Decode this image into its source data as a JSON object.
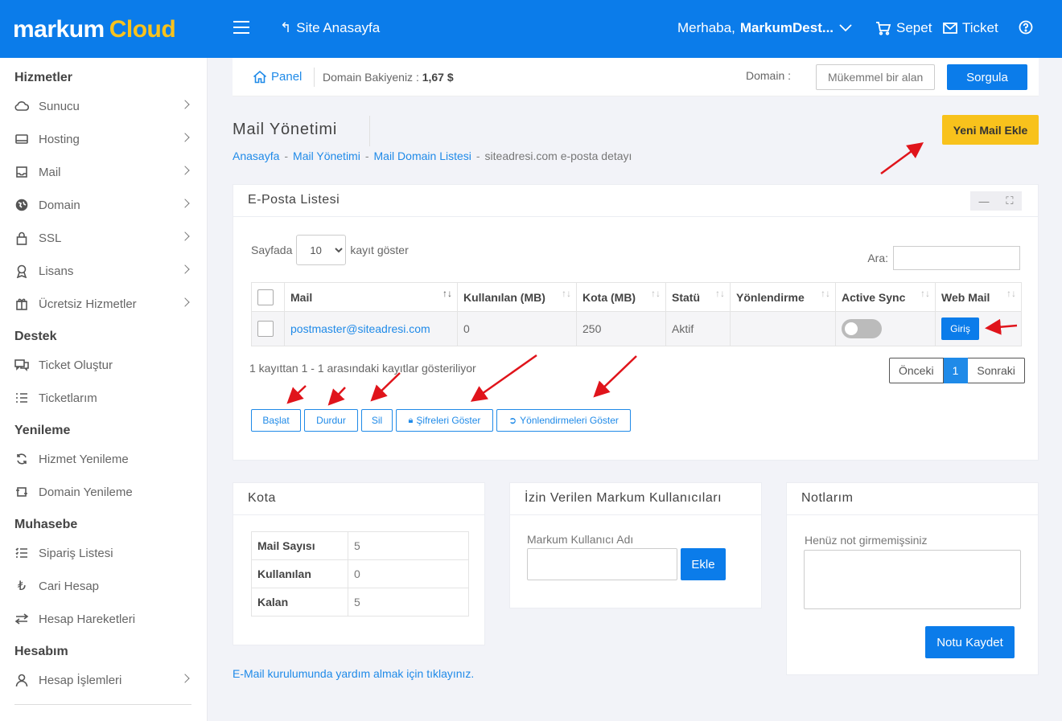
{
  "header": {
    "logo_main": "markum",
    "logo_accent": "Cloud",
    "site_home": "Site Anasayfa",
    "greeting": "Merhaba,",
    "username": "MarkumDest...",
    "cart": "Sepet",
    "ticket": "Ticket"
  },
  "sidebar": {
    "sections": [
      {
        "title": "Hizmetler",
        "items": [
          {
            "label": "Sunucu",
            "icon": "cloud-icon",
            "chevron": true
          },
          {
            "label": "Hosting",
            "icon": "server-icon",
            "chevron": true
          },
          {
            "label": "Mail",
            "icon": "inbox-icon",
            "chevron": true
          },
          {
            "label": "Domain",
            "icon": "globe-icon",
            "chevron": true
          },
          {
            "label": "SSL",
            "icon": "lock-icon",
            "chevron": true
          },
          {
            "label": "Lisans",
            "icon": "award-icon",
            "chevron": true
          },
          {
            "label": "Ücretsiz Hizmetler",
            "icon": "gift-icon",
            "chevron": true
          }
        ]
      },
      {
        "title": "Destek",
        "items": [
          {
            "label": "Ticket Oluştur",
            "icon": "chat-icon",
            "chevron": false
          },
          {
            "label": "Ticketlarım",
            "icon": "list-icon",
            "chevron": false
          }
        ]
      },
      {
        "title": "Yenileme",
        "items": [
          {
            "label": "Hizmet Yenileme",
            "icon": "refresh-icon",
            "chevron": false
          },
          {
            "label": "Domain Yenileme",
            "icon": "renew-icon",
            "chevron": false
          }
        ]
      },
      {
        "title": "Muhasebe",
        "items": [
          {
            "label": "Sipariş Listesi",
            "icon": "checklist-icon",
            "chevron": false
          },
          {
            "label": "Cari Hesap",
            "icon": "lira-icon",
            "chevron": false
          },
          {
            "label": "Hesap Hareketleri",
            "icon": "transfer-icon",
            "chevron": false
          }
        ]
      },
      {
        "title": "Hesabım",
        "items": [
          {
            "label": "Hesap İşlemleri",
            "icon": "user-icon",
            "chevron": true
          }
        ]
      }
    ]
  },
  "panelbar": {
    "panel": "Panel",
    "balance_label": "Domain Bakiyeniz :",
    "balance_value": "1,67 $",
    "domain_label": "Domain :",
    "domain_placeholder": "Mükemmel bir alan",
    "search_button": "Sorgula"
  },
  "page": {
    "title": "Mail Yönetimi",
    "breadcrumb": [
      "Anasayfa",
      "Mail Yönetimi",
      "Mail Domain Listesi",
      "siteadresi.com e-posta detayı"
    ],
    "new_mail_button": "Yeni Mail Ekle"
  },
  "email_list": {
    "title": "E-Posta Listesi",
    "length_prefix": "Sayfada",
    "length_value": "10",
    "length_suffix": "kayıt göster",
    "search_label": "Ara:",
    "columns": [
      "Mail",
      "Kullanılan (MB)",
      "Kota (MB)",
      "Statü",
      "Yönlendirme",
      "Active Sync",
      "Web Mail"
    ],
    "rows": [
      {
        "mail": "postmaster@siteadresi.com",
        "used": "0",
        "quota": "250",
        "status": "Aktif",
        "redirect": "",
        "active_sync": false,
        "webmail_button": "Giriş"
      }
    ],
    "info": "1 kayıttan 1 - 1 arasındaki kayıtlar gösteriliyor",
    "pagination": {
      "prev": "Önceki",
      "current": "1",
      "next": "Sonraki"
    },
    "actions": {
      "start": "Başlat",
      "stop": "Durdur",
      "delete": "Sil",
      "show_passwords": "Şifreleri Göster",
      "show_redirects": "Yönlendirmeleri Göster"
    }
  },
  "quota": {
    "title": "Kota",
    "rows": [
      {
        "label": "Mail Sayısı",
        "value": "5"
      },
      {
        "label": "Kullanılan",
        "value": "0"
      },
      {
        "label": "Kalan",
        "value": "5"
      }
    ]
  },
  "allowed_users": {
    "title": "İzin Verilen Markum Kullanıcıları",
    "field_label": "Markum Kullanıcı Adı",
    "add_button": "Ekle"
  },
  "notes": {
    "title": "Notlarım",
    "empty_text": "Henüz not girmemişsiniz",
    "save_button": "Notu Kaydet"
  },
  "help_link": "E-Mail kurulumunda yardım almak için tıklayınız.",
  "colors": {
    "primary": "#0b7cea",
    "accent": "#f8c21c",
    "annotation": "#e0141b"
  }
}
